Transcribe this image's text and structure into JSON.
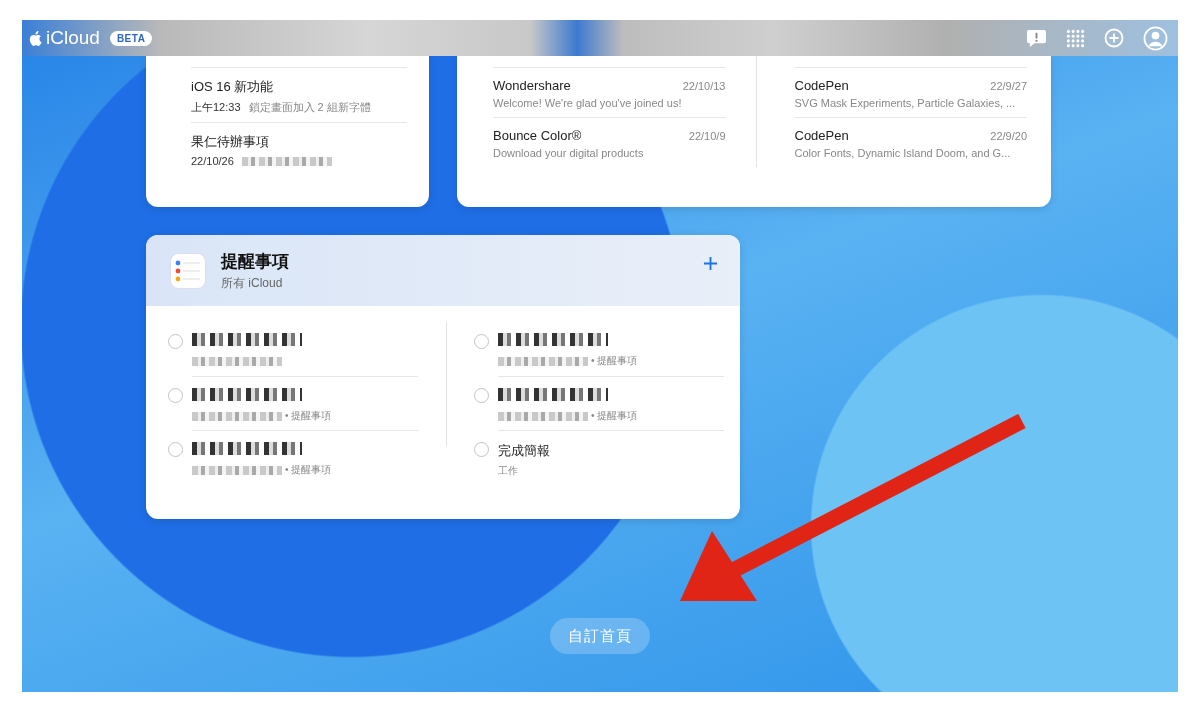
{
  "topbar": {
    "brand": "iCloud",
    "badge": "BETA"
  },
  "notes": {
    "items": [
      {
        "title": "iOS 16 新功能",
        "time": "上午12:33",
        "preview": "鎖定畫面加入 2 組新字體"
      },
      {
        "title": "果仁待辦事項",
        "time": "22/10/26"
      }
    ]
  },
  "mail": {
    "columns": [
      {
        "items": [
          {
            "sender": "Wondershare",
            "date": "22/10/13",
            "preview": "Welcome! We're glad you've joined us!"
          },
          {
            "sender": "Bounce Color®",
            "date": "22/10/9",
            "preview": "Download your digital products"
          }
        ]
      },
      {
        "items": [
          {
            "sender": "CodePen",
            "date": "22/9/27",
            "preview": "SVG Mask Experiments, Particle Galaxies, ..."
          },
          {
            "sender": "CodePen",
            "date": "22/9/20",
            "preview": "Color Fonts, Dynamic Island Doom, and G..."
          }
        ]
      }
    ]
  },
  "reminders": {
    "title": "提醒事項",
    "subtitle": "所有 iCloud",
    "columns": [
      {
        "items": [
          {
            "checked": false
          },
          {
            "checked": false,
            "list": "• 提醒事項",
            "detail_hidden": true
          },
          {
            "checked": false,
            "list": "• 提醒事項",
            "detail_hidden": true
          }
        ]
      },
      {
        "items": [
          {
            "checked": false,
            "list": "• 提醒事項",
            "detail_hidden": true
          },
          {
            "checked": false,
            "list": "• 提醒事項",
            "detail_hidden": true
          },
          {
            "checked": false,
            "title": "完成簡報",
            "list": "工作",
            "detail_hidden": false
          }
        ]
      }
    ]
  },
  "customize_button": "自訂首頁"
}
